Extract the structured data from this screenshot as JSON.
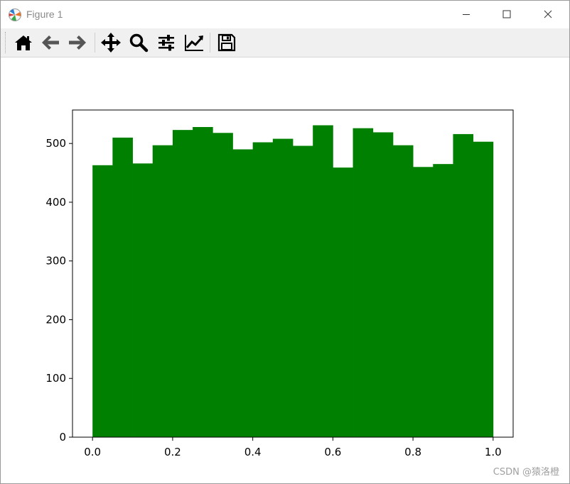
{
  "window": {
    "title": "Figure 1",
    "icons": {
      "app": "matplotlib-icon",
      "minimize": "minimize-icon",
      "maximize": "maximize-icon",
      "close": "close-icon"
    }
  },
  "toolbar": {
    "buttons": [
      {
        "name": "home",
        "icon": "home-icon"
      },
      {
        "name": "back",
        "icon": "arrow-left-icon"
      },
      {
        "name": "forward",
        "icon": "arrow-right-icon"
      },
      {
        "name": "pan",
        "icon": "move-icon"
      },
      {
        "name": "zoom",
        "icon": "magnifier-icon"
      },
      {
        "name": "configure-subplots",
        "icon": "sliders-icon"
      },
      {
        "name": "edit-axis",
        "icon": "line-chart-icon"
      },
      {
        "name": "save",
        "icon": "floppy-disk-icon"
      }
    ]
  },
  "watermark": "CSDN @猿洛橙",
  "chart_data": {
    "type": "bar",
    "histogram": true,
    "bin_edges": [
      0.0,
      0.05,
      0.1,
      0.15,
      0.2,
      0.25,
      0.3,
      0.35,
      0.4,
      0.45,
      0.5,
      0.55,
      0.6,
      0.65,
      0.7,
      0.75,
      0.8,
      0.85,
      0.9,
      0.95,
      1.0
    ],
    "values": [
      463,
      510,
      466,
      497,
      523,
      528,
      518,
      490,
      502,
      508,
      496,
      531,
      459,
      526,
      519,
      497,
      460,
      465,
      516,
      503
    ],
    "color": "#008000",
    "xlim": [
      -0.05,
      1.05
    ],
    "ylim": [
      0,
      557
    ],
    "xticks": [
      0.0,
      0.2,
      0.4,
      0.6,
      0.8,
      1.0
    ],
    "xtick_labels": [
      "0.0",
      "0.2",
      "0.4",
      "0.6",
      "0.8",
      "1.0"
    ],
    "yticks": [
      0,
      100,
      200,
      300,
      400,
      500
    ],
    "ytick_labels": [
      "0",
      "100",
      "200",
      "300",
      "400",
      "500"
    ],
    "grid": false,
    "title": "",
    "xlabel": "",
    "ylabel": ""
  }
}
